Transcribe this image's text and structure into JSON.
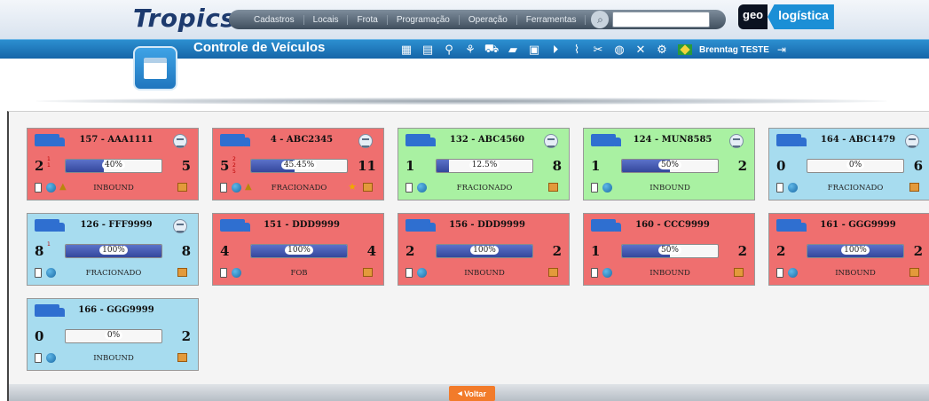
{
  "app": {
    "brand": "Tropics",
    "logo_geo": "geo",
    "logo_rest": "logística"
  },
  "menu": {
    "items": [
      "Cadastros",
      "Locais",
      "Frota",
      "Programação",
      "Operação",
      "Ferramentas"
    ],
    "search_placeholder": ""
  },
  "header": {
    "title": "Controle de Veículos",
    "toolbar_icons": [
      "chart-icon",
      "grid-icon",
      "pin-icon",
      "route-icon",
      "truck-side-icon",
      "folder-icon",
      "document-icon",
      "play-icon",
      "flow-icon",
      "tools-icon",
      "globe-icon",
      "wrench-cross-icon",
      "settings-icon"
    ],
    "user": "Brenntag TESTE"
  },
  "vehicles": [
    {
      "title": "157 - AAA1111",
      "color": "red",
      "left": "2",
      "right": "5",
      "percent_label": "40%",
      "percent": 40,
      "status": "INBOUND",
      "mini": [
        "1",
        "1"
      ],
      "bell": true,
      "star": false
    },
    {
      "title": "4 - ABC2345",
      "color": "red",
      "left": "5",
      "right": "11",
      "percent_label": "45.45%",
      "percent": 45.45,
      "status": "FRACIONADO",
      "mini": [
        "2",
        "2",
        "5"
      ],
      "bell": true,
      "star": true
    },
    {
      "title": "132 - ABC4560",
      "color": "green",
      "left": "1",
      "right": "8",
      "percent_label": "12.5%",
      "percent": 12.5,
      "status": "FRACIONADO",
      "mini": [],
      "bell": false,
      "star": false
    },
    {
      "title": "124 - MUN8585",
      "color": "green",
      "left": "1",
      "right": "2",
      "percent_label": "50%",
      "percent": 50,
      "status": "INBOUND",
      "mini": [],
      "bell": false,
      "star": false
    },
    {
      "title": "164 - ABC1479",
      "color": "blue",
      "left": "0",
      "right": "6",
      "percent_label": "0%",
      "percent": 0,
      "status": "FRACIONADO",
      "mini": [],
      "bell": false,
      "star": false
    },
    {
      "title": "126 - FFF9999",
      "color": "blue",
      "left": "8",
      "right": "8",
      "percent_label": "100%",
      "percent": 100,
      "status": "FRACIONADO",
      "mini": [
        "1"
      ],
      "bell": false,
      "star": false
    },
    {
      "title": "151 - DDD9999",
      "color": "red",
      "left": "4",
      "right": "4",
      "percent_label": "100%",
      "percent": 100,
      "status": "FOB",
      "mini": [],
      "bell": false,
      "star": false
    },
    {
      "title": "156 - DDD9999",
      "color": "red",
      "left": "2",
      "right": "2",
      "percent_label": "100%",
      "percent": 100,
      "status": "INBOUND",
      "mini": [],
      "bell": false,
      "star": false
    },
    {
      "title": "160 - CCC9999",
      "color": "red",
      "left": "1",
      "right": "2",
      "percent_label": "50%",
      "percent": 50,
      "status": "INBOUND",
      "mini": [],
      "bell": false,
      "star": false
    },
    {
      "title": "161 - GGG9999",
      "color": "red",
      "left": "2",
      "right": "2",
      "percent_label": "100%",
      "percent": 100,
      "status": "INBOUND",
      "mini": [],
      "bell": false,
      "star": false
    },
    {
      "title": "166 - GGG9999",
      "color": "blue",
      "left": "0",
      "right": "2",
      "percent_label": "0%",
      "percent": 0,
      "status": "INBOUND",
      "mini": [],
      "bell": false,
      "star": false
    }
  ],
  "footer": {
    "back_label": "Voltar"
  }
}
